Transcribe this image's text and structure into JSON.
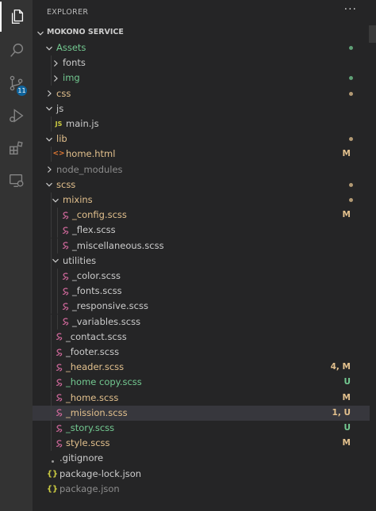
{
  "explorer": {
    "title": "EXPLORER",
    "more": "···"
  },
  "section": {
    "title": "MOKONO SERVICE"
  },
  "scm": {
    "badge": "11"
  },
  "colors": {
    "green": "#73c991",
    "yellow": "#e2c08d",
    "gray": "#8c8c8c",
    "sass": "#cd6799",
    "js": "#cbcb41",
    "html": "#e37933",
    "json": "#cbcb41"
  },
  "tree": [
    {
      "name": "Assets",
      "depth": 0,
      "type": "folder",
      "open": true,
      "color": "green",
      "deco": "dot-green"
    },
    {
      "name": "fonts",
      "depth": 1,
      "type": "folder",
      "open": false,
      "color": "default",
      "deco": ""
    },
    {
      "name": "img",
      "depth": 1,
      "type": "folder",
      "open": false,
      "color": "green",
      "deco": "dot-green"
    },
    {
      "name": "css",
      "depth": 0,
      "type": "folder",
      "open": false,
      "color": "yellow",
      "deco": "dot-yellow"
    },
    {
      "name": "js",
      "depth": 0,
      "type": "folder",
      "open": true,
      "color": "default",
      "deco": ""
    },
    {
      "name": "main.js",
      "depth": 1,
      "type": "js",
      "color": "default",
      "deco": ""
    },
    {
      "name": "lib",
      "depth": 0,
      "type": "folder",
      "open": true,
      "color": "yellow",
      "deco": "dot-yellow"
    },
    {
      "name": "home.html",
      "depth": 1,
      "type": "html",
      "color": "yellow",
      "deco": "M"
    },
    {
      "name": "node_modules",
      "depth": 0,
      "type": "folder",
      "open": false,
      "color": "gray",
      "deco": ""
    },
    {
      "name": "scss",
      "depth": 0,
      "type": "folder",
      "open": true,
      "color": "yellow",
      "deco": "dot-yellow"
    },
    {
      "name": "mixins",
      "depth": 1,
      "type": "folder",
      "open": true,
      "color": "yellow",
      "deco": "dot-yellow"
    },
    {
      "name": "_config.scss",
      "depth": 2,
      "type": "scss",
      "color": "yellow",
      "deco": "M"
    },
    {
      "name": "_flex.scss",
      "depth": 2,
      "type": "scss",
      "color": "default",
      "deco": ""
    },
    {
      "name": "_miscellaneous.scss",
      "depth": 2,
      "type": "scss",
      "color": "default",
      "deco": ""
    },
    {
      "name": "utilities",
      "depth": 1,
      "type": "folder",
      "open": true,
      "color": "default",
      "deco": ""
    },
    {
      "name": "_color.scss",
      "depth": 2,
      "type": "scss",
      "color": "default",
      "deco": ""
    },
    {
      "name": "_fonts.scss",
      "depth": 2,
      "type": "scss",
      "color": "default",
      "deco": ""
    },
    {
      "name": "_responsive.scss",
      "depth": 2,
      "type": "scss",
      "color": "default",
      "deco": ""
    },
    {
      "name": "_variables.scss",
      "depth": 2,
      "type": "scss",
      "color": "default",
      "deco": ""
    },
    {
      "name": "_contact.scss",
      "depth": 1,
      "type": "scss",
      "color": "default",
      "deco": ""
    },
    {
      "name": "_footer.scss",
      "depth": 1,
      "type": "scss",
      "color": "default",
      "deco": ""
    },
    {
      "name": "_header.scss",
      "depth": 1,
      "type": "scss",
      "color": "yellow",
      "deco": "4, M"
    },
    {
      "name": "_home copy.scss",
      "depth": 1,
      "type": "scss",
      "color": "green",
      "deco": "U"
    },
    {
      "name": "_home.scss",
      "depth": 1,
      "type": "scss",
      "color": "yellow",
      "deco": "M"
    },
    {
      "name": "_mission.scss",
      "depth": 1,
      "type": "scss",
      "color": "yellow",
      "deco": "1, U",
      "selected": true
    },
    {
      "name": "_story.scss",
      "depth": 1,
      "type": "scss",
      "color": "green",
      "deco": "U"
    },
    {
      "name": "style.scss",
      "depth": 1,
      "type": "scss",
      "color": "yellow",
      "deco": "M"
    },
    {
      "name": ".gitignore",
      "depth": 0,
      "type": "git",
      "color": "default",
      "deco": ""
    },
    {
      "name": "package-lock.json",
      "depth": 0,
      "type": "json",
      "color": "default",
      "deco": ""
    },
    {
      "name": "package.json",
      "depth": 0,
      "type": "json",
      "color": "gray",
      "deco": ""
    }
  ]
}
